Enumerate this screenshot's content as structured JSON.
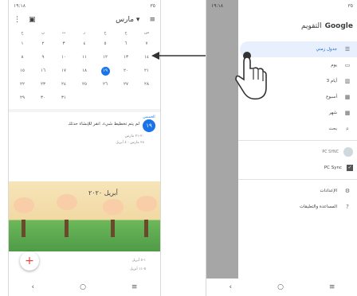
{
  "left": {
    "status": {
      "time": "١٩:١٨",
      "battery": "٣٥"
    },
    "header": {
      "month": "مارس ▾"
    },
    "weekdays": [
      "ح",
      "ن",
      "ث",
      "ر",
      "خ",
      "ج",
      "س"
    ],
    "weeks": [
      [
        "١",
        "٢",
        "٣",
        "٤",
        "٥",
        "٦",
        "٧"
      ],
      [
        "٨",
        "٩",
        "١٠",
        "١١",
        "١٢",
        "١٣",
        "١٤"
      ],
      [
        "١٥",
        "١٦",
        "١٧",
        "١٨",
        "١٩",
        "٢٠",
        "٢١"
      ],
      [
        "٢٢",
        "٢٣",
        "٢٤",
        "٢٥",
        "٢٦",
        "٢٧",
        "٢٨"
      ],
      [
        "٢٩",
        "٣٠",
        "٣١",
        "",
        "",
        "",
        ""
      ]
    ],
    "today_label": "١٩",
    "event": {
      "day_label": "الخميس",
      "day_number": "١٩",
      "text": "لم يتم تخطيط شيء. انقر للإنشاء حدثك"
    },
    "ranges": [
      "٢٠-٢١ مارس",
      "٢٨ مارس - ٤ أبريل"
    ],
    "banner_title": "أبريل ٢٠٢٠",
    "after": [
      "١-٥ أبريل",
      "٥-١١ أبريل"
    ],
    "fab": "+"
  },
  "right": {
    "status": {
      "time": "١٩:١٨",
      "battery": "٣٥"
    },
    "drawer": {
      "title": "التقويم",
      "brand": "Google",
      "items": [
        {
          "label": "جدول زمني",
          "icon": "☰",
          "selected": true
        },
        {
          "label": "يوم",
          "icon": "▭"
        },
        {
          "label": "3 أيام",
          "icon": "▥"
        },
        {
          "label": "أسبوع",
          "icon": "▦"
        },
        {
          "label": "شهر",
          "icon": "▦"
        },
        {
          "label": "بحث",
          "icon": "⌕"
        }
      ],
      "account_label": "PC SYNC",
      "sync_label": "PC Sync",
      "settings_label": "الإعدادات",
      "help_label": "المساعدة والتعليقات"
    }
  },
  "nav": {
    "back": "‹",
    "home": "○",
    "menu": "≡"
  },
  "colors": {
    "accent": "#1a73e8",
    "selection": "#e8f0fe"
  }
}
